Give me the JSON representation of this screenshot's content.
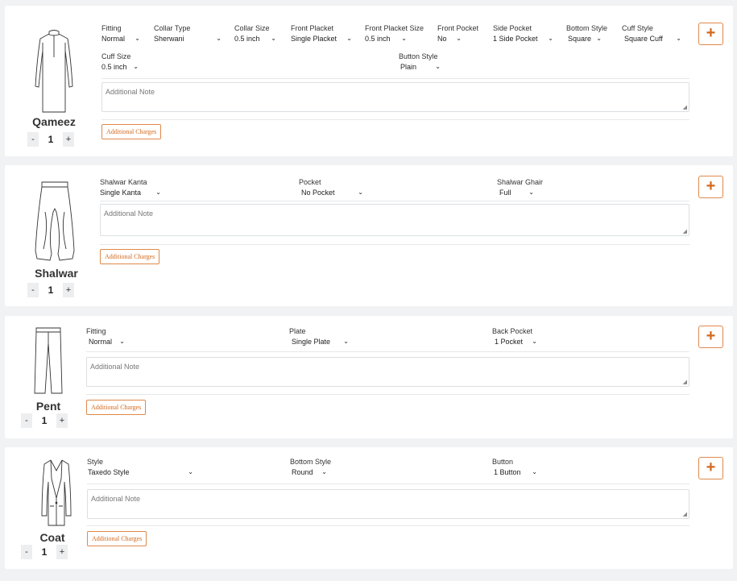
{
  "cards": [
    {
      "name": "Qameez",
      "quantity": "1",
      "fields": [
        {
          "label": "Fitting",
          "value": "Normal"
        },
        {
          "label": "Collar Type",
          "value": "Sherwani"
        },
        {
          "label": "Collar Size",
          "value": "0.5 inch"
        },
        {
          "label": "Front Placket",
          "value": "Single Placket"
        },
        {
          "label": "Front Placket Size",
          "value": "0.5 inch"
        },
        {
          "label": "Front Pocket",
          "value": "No"
        },
        {
          "label": "Side Pocket",
          "value": "1 Side Pocket"
        },
        {
          "label": "Bottom Style",
          "value": "Square"
        },
        {
          "label": "Cuff Style",
          "value": "Square Cuff"
        },
        {
          "label": "Cuff Size",
          "value": "0.5 inch"
        },
        {
          "label": "Button Style",
          "value": "Plain"
        }
      ],
      "note_placeholder": "Additional Note",
      "charges_label": "Additional Charges",
      "add_label": "+"
    },
    {
      "name": "Shalwar",
      "quantity": "1",
      "fields": [
        {
          "label": "Shalwar Kanta",
          "value": "Single Kanta"
        },
        {
          "label": "Pocket",
          "value": "No Pocket"
        },
        {
          "label": "Shalwar Ghair",
          "value": "Full"
        }
      ],
      "note_placeholder": "Additional Note",
      "charges_label": "Additional Charges",
      "add_label": "+"
    },
    {
      "name": "Pent",
      "quantity": "1",
      "fields": [
        {
          "label": "Fitting",
          "value": "Normal"
        },
        {
          "label": "Plate",
          "value": "Single Plate"
        },
        {
          "label": "Back Pocket",
          "value": "1 Pocket"
        }
      ],
      "note_placeholder": "Additional Note",
      "charges_label": "Additional Charges",
      "add_label": "+"
    },
    {
      "name": "Coat",
      "quantity": "1",
      "fields": [
        {
          "label": "Style",
          "value": "Taxedo Style"
        },
        {
          "label": "Bottom Style",
          "value": "Round"
        },
        {
          "label": "Button",
          "value": "1 Button"
        }
      ],
      "note_placeholder": "Additional Note",
      "charges_label": "Additional Charges",
      "add_label": "+"
    }
  ],
  "qty_minus": "-",
  "qty_plus": "+",
  "colors": {
    "accent": "#d2691e",
    "background": "#f1f2f4",
    "card": "#ffffff"
  }
}
